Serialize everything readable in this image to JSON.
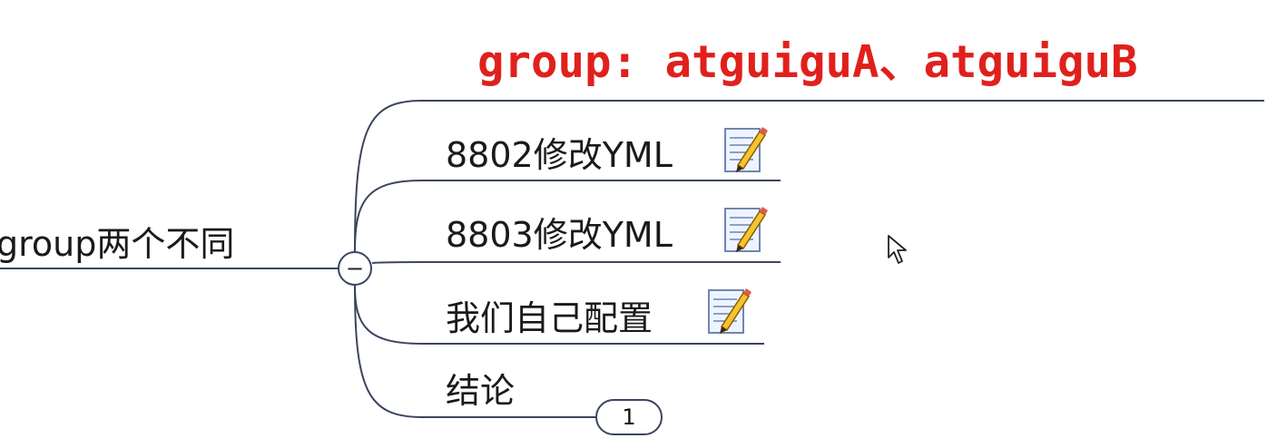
{
  "title": {
    "text": "group: atguiguA、atguiguB",
    "color": "#e0201c"
  },
  "parent": {
    "label": "group两个不同",
    "collapse_symbol": "−"
  },
  "children": [
    {
      "label": "8802修改YML",
      "icon": "notes-pencil-icon"
    },
    {
      "label": "8803修改YML",
      "icon": "notes-pencil-icon"
    },
    {
      "label": "我们自己配置",
      "icon": "notes-pencil-icon"
    },
    {
      "label": "结论",
      "hidden_children_count": "1"
    }
  ],
  "colors": {
    "branch_line": "#3b4560"
  }
}
